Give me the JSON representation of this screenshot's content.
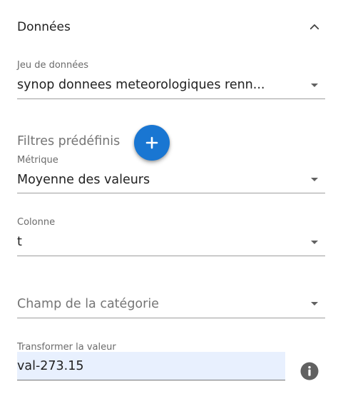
{
  "section": {
    "title": "Données",
    "icon": "chevron-up-icon"
  },
  "dataset": {
    "label": "Jeu de données",
    "value": "synop donnees meteorologiques renn..."
  },
  "filters": {
    "title": "Filtres prédéfinis",
    "add_icon": "plus-icon"
  },
  "metric": {
    "label": "Métrique",
    "value": "Moyenne des valeurs"
  },
  "column": {
    "label": "Colonne",
    "value": "t"
  },
  "category": {
    "placeholder": "Champ de la catégorie"
  },
  "transform": {
    "label": "Transformer la valeur",
    "value": "val-273.15",
    "info_icon": "info-icon"
  },
  "colors": {
    "accent": "#1976d2",
    "input_bg": "#e8f0fe"
  }
}
